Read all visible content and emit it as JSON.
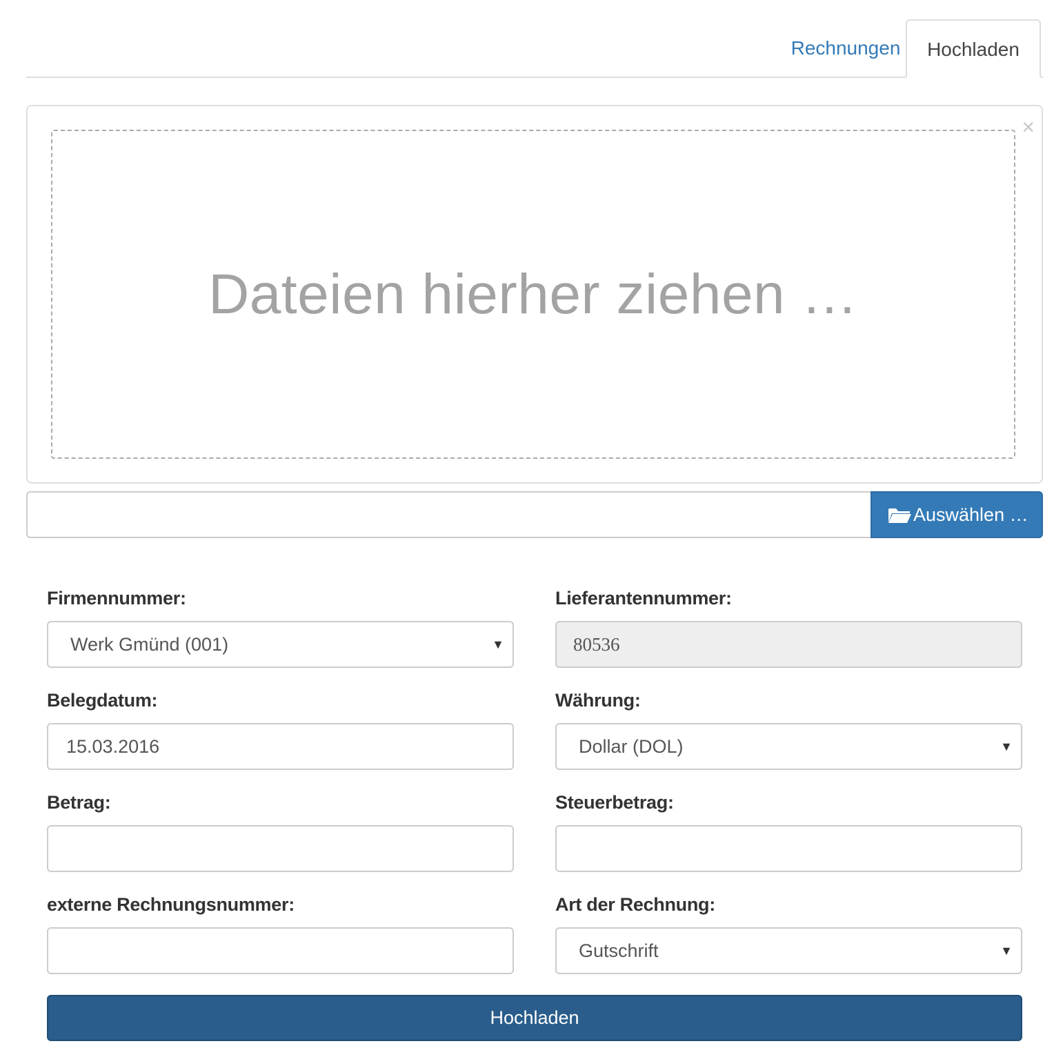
{
  "tabs": {
    "invoices_label": "Rechnungen",
    "upload_label": "Hochladen"
  },
  "dropzone": {
    "text": "Dateien hierher ziehen …",
    "close_glyph": "×"
  },
  "file_input": {
    "caption": "",
    "browse_label": "Auswählen …",
    "browse_icon": "folder-open-icon"
  },
  "form": {
    "company": {
      "label": "Firmennummer:",
      "value": "Werk Gmünd (001)"
    },
    "supplier": {
      "label": "Lieferantennummer:",
      "value": "80536"
    },
    "document_date": {
      "label": "Belegdatum:",
      "value": "15.03.2016"
    },
    "currency": {
      "label": "Währung:",
      "value": "Dollar (DOL)"
    },
    "amount": {
      "label": "Betrag:",
      "value": ""
    },
    "tax_amount": {
      "label": "Steuerbetrag:",
      "value": ""
    },
    "external_invoice_number": {
      "label": "externe Rechnungsnummer:",
      "value": ""
    },
    "invoice_type": {
      "label": "Art der Rechnung:",
      "value": "Gutschrift"
    },
    "caret_glyph": "▼",
    "submit_label": "Hochladen"
  },
  "colors": {
    "primary": "#337ab7",
    "submit": "#2a5d8c",
    "link": "#337ab7",
    "readonly_bg": "#eeeeee"
  }
}
